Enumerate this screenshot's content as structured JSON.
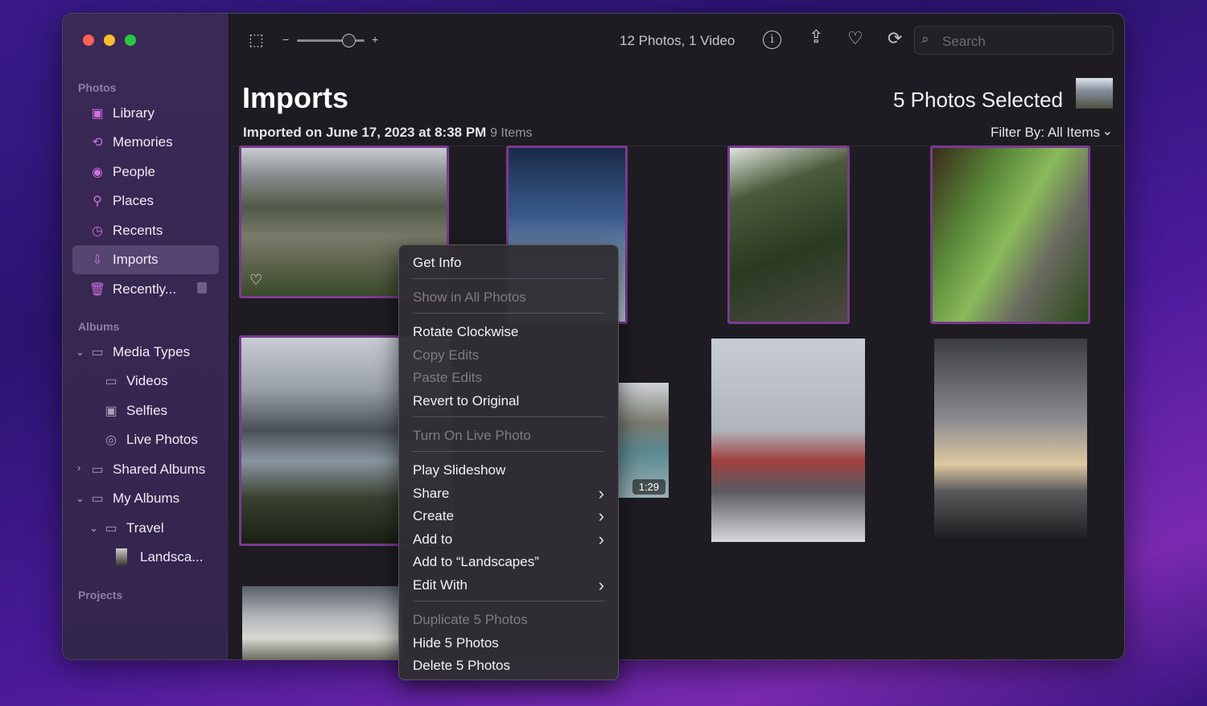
{
  "sidebar": {
    "sections": {
      "photos": "Photos",
      "albums": "Albums",
      "projects": "Projects"
    },
    "items": [
      {
        "label": "Library",
        "icon": "library-icon"
      },
      {
        "label": "Memories",
        "icon": "memories-icon"
      },
      {
        "label": "People",
        "icon": "people-icon"
      },
      {
        "label": "Places",
        "icon": "places-icon"
      },
      {
        "label": "Recents",
        "icon": "recents-icon"
      },
      {
        "label": "Imports",
        "icon": "imports-icon",
        "selected": true
      },
      {
        "label": "Recently...",
        "icon": "trash-icon",
        "locked": true
      }
    ],
    "albums": [
      {
        "label": "Media Types",
        "expanded": true
      },
      {
        "label": "Videos"
      },
      {
        "label": "Selfies"
      },
      {
        "label": "Live Photos"
      },
      {
        "label": "Shared Albums",
        "expanded": false
      },
      {
        "label": "My Albums",
        "expanded": true
      },
      {
        "label": "Travel",
        "expanded": true
      },
      {
        "label": "Landsca..."
      }
    ]
  },
  "toolbar": {
    "count": "12 Photos, 1 Video",
    "search_placeholder": "Search",
    "zoom_minus": "−",
    "zoom_plus": "+"
  },
  "header": {
    "title": "Imports",
    "selected": "5 Photos Selected",
    "subtitle": "Imported on June 17, 2023 at 8:38 PM",
    "items": "9 Items",
    "filter": "Filter By: All Items"
  },
  "grid": {
    "video_duration": "1:29"
  },
  "colors": {
    "accent": "#d070e0",
    "selection": "#7a3b8e"
  },
  "menu": [
    {
      "label": "Get Info"
    },
    {
      "label": "Show in All Photos",
      "disabled": true
    },
    {
      "label": "Rotate Clockwise"
    },
    {
      "label": "Copy Edits",
      "disabled": true
    },
    {
      "label": "Paste Edits",
      "disabled": true
    },
    {
      "label": "Revert to Original"
    },
    {
      "label": "Turn On Live Photo",
      "disabled": true
    },
    {
      "label": "Play Slideshow"
    },
    {
      "label": "Share",
      "submenu": true
    },
    {
      "label": "Create",
      "submenu": true
    },
    {
      "label": "Add to",
      "submenu": true
    },
    {
      "label": "Add to “Landscapes”"
    },
    {
      "label": "Edit With",
      "submenu": true
    },
    {
      "label": "Duplicate 5 Photos",
      "disabled": true
    },
    {
      "label": "Hide 5 Photos"
    },
    {
      "label": "Delete 5 Photos"
    }
  ]
}
